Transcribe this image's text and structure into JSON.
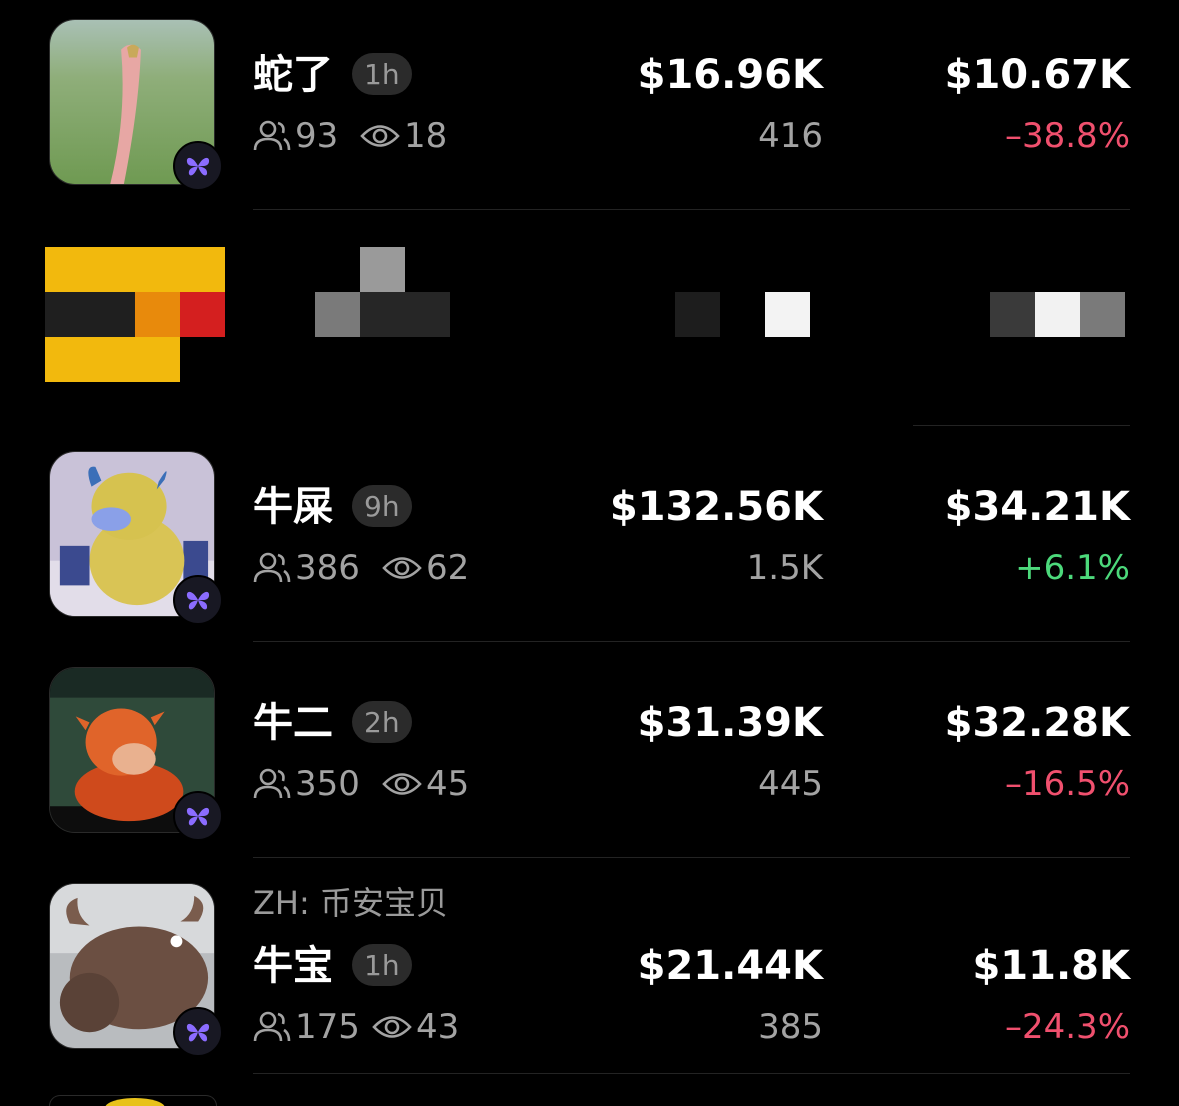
{
  "colors": {
    "background": "#000000",
    "negative": "#f0506e",
    "positive": "#4cd97b",
    "badge_accent": "#8b6cff"
  },
  "rows": [
    {
      "name": "蛇了",
      "age": "1h",
      "holders": "93",
      "views": "18",
      "market_cap": "$16.96K",
      "volume": "416",
      "price": "$10.67K",
      "change": "–38.8%",
      "change_dir": "down",
      "thumb_icon": "snake-thumbnail"
    },
    {
      "name": "牛屎",
      "age": "9h",
      "holders": "386",
      "views": "62",
      "market_cap": "$132.56K",
      "volume": "1.5K",
      "price": "$34.21K",
      "change": "+6.1%",
      "change_dir": "up",
      "thumb_icon": "yellow-bull-thumbnail"
    },
    {
      "name": "牛二",
      "age": "2h",
      "holders": "350",
      "views": "45",
      "market_cap": "$31.39K",
      "volume": "445",
      "price": "$32.28K",
      "change": "–16.5%",
      "change_dir": "down",
      "thumb_icon": "orange-bull-thumbnail"
    },
    {
      "subtitle": "ZH: 币安宝贝",
      "name": "牛宝",
      "age": "1h",
      "holders": "175",
      "views": "43",
      "market_cap": "$21.44K",
      "volume": "385",
      "price": "$11.8K",
      "change": "–24.3%",
      "change_dir": "down",
      "thumb_icon": "plush-bull-thumbnail"
    }
  ],
  "icons": {
    "holders": "users-icon",
    "views": "eye-icon",
    "badge": "butterfly-icon"
  }
}
